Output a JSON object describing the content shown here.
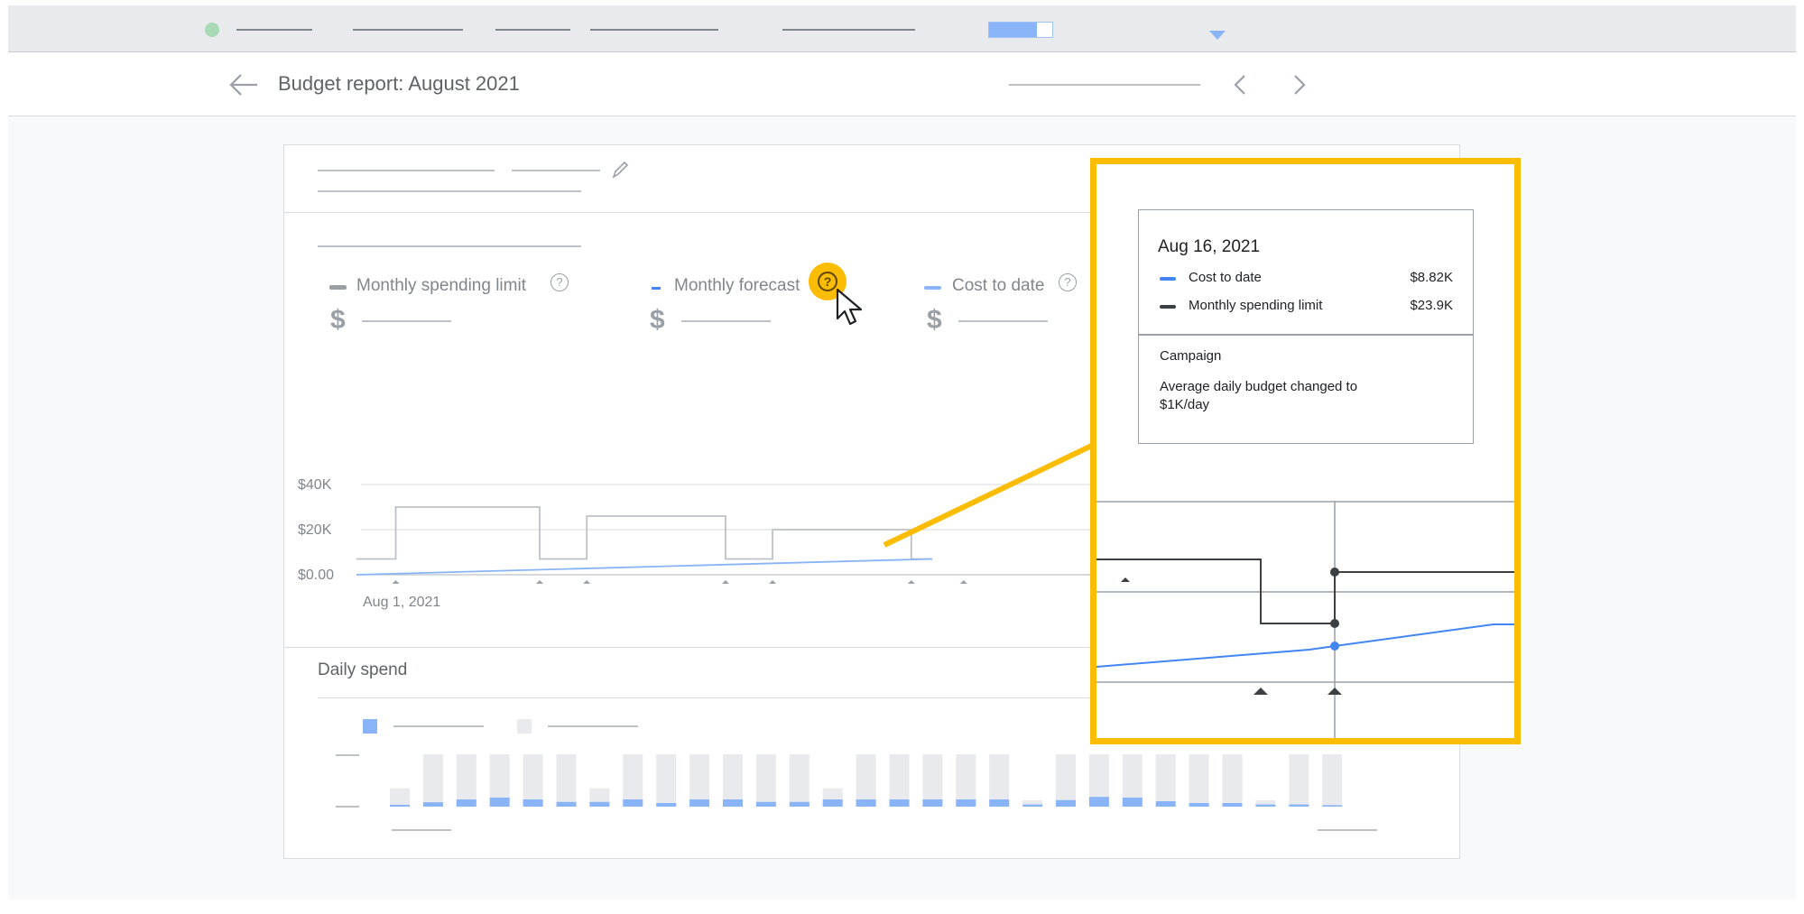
{
  "topbar": {
    "toggle_fill": 0.75,
    "colors": {
      "bar_bg": "#e8eaed",
      "accent": "#8ab4f8",
      "status": "#a8dab5"
    }
  },
  "header": {
    "back_icon": "back-arrow-icon",
    "title": "Budget report: August 2021",
    "prev_icon": "chevron-left-icon",
    "next_icon": "chevron-right-icon"
  },
  "legend": {
    "items": [
      {
        "label": "Monthly spending limit",
        "color": "#9aa0a6",
        "currency": "$",
        "help_icon": "help-circle-icon"
      },
      {
        "label": "Monthly forecast",
        "color": "#4285f4",
        "currency": "$",
        "help_icon": "help-circle-icon",
        "highlighted": true
      },
      {
        "label": "Cost to date",
        "color": "#8ab4f8",
        "currency": "$",
        "help_icon": "help-circle-icon"
      }
    ],
    "help_glyph": "?"
  },
  "chart_data": [
    {
      "type": "line",
      "y_ticks": [
        "$40K",
        "$20K",
        "$0.00"
      ],
      "ylim": [
        0,
        40000
      ],
      "x_start_label": "Aug 1, 2021",
      "series": [
        {
          "name": "Monthly spending limit",
          "color": "#bdc1c6",
          "steps": [
            [
              0,
              7000
            ],
            [
              1.5,
              30000
            ],
            [
              7,
              7000
            ],
            [
              8.8,
              26000
            ],
            [
              14.1,
              7000
            ],
            [
              15.9,
              20000
            ],
            [
              21.2,
              7000
            ],
            [
              22,
              7000
            ]
          ]
        },
        {
          "name": "Cost to date",
          "color": "#8ab4f8",
          "points": [
            [
              0,
              0
            ],
            [
              22,
              7000
            ]
          ]
        }
      ],
      "markers": [
        1.5,
        7,
        8.8,
        14.1,
        15.9,
        21.2,
        23.2
      ]
    },
    {
      "type": "bar",
      "title": "Daily spend",
      "stacked": true,
      "series": [
        {
          "color": "#8ab4f8",
          "values": [
            0.05,
            0.12,
            0.2,
            0.25,
            0.2,
            0.13,
            0.13,
            0.2,
            0.1,
            0.2,
            0.2,
            0.13,
            0.13,
            0.2,
            0.2,
            0.2,
            0.2,
            0.2,
            0.2,
            0.06,
            0.18,
            0.27,
            0.25,
            0.15,
            0.1,
            0.1,
            0.06,
            0.06,
            0.04
          ]
        },
        {
          "color": "#e8eaed",
          "values": [
            0.35,
            1,
            1,
            1,
            1,
            1,
            0.35,
            1,
            1,
            1,
            1,
            1,
            1,
            0.35,
            1,
            1,
            1,
            1,
            1,
            0.12,
            1,
            1,
            1,
            1,
            1,
            1,
            0.12,
            1,
            1
          ]
        }
      ]
    }
  ],
  "daily_spend": {
    "title": "Daily spend"
  },
  "zoom": {
    "tooltip": {
      "date": "Aug 16, 2021",
      "rows": [
        {
          "label": "Cost to date",
          "value": "$8.82K",
          "color": "#4285f4"
        },
        {
          "label": "Monthly spending limit",
          "value": "$23.9K",
          "color": "#3c4043"
        }
      ],
      "section_title": "Campaign",
      "note_line1": "Average daily budget changed to",
      "note_line2": "$1K/day"
    },
    "highlight_color": "#fbbc04"
  },
  "cursor_icon": "pointer-cursor-icon"
}
